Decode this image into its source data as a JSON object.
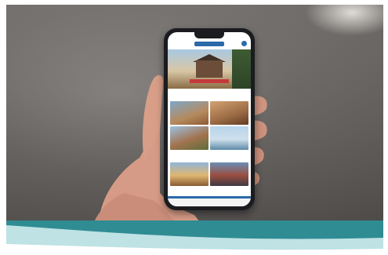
{
  "scene": {
    "description_label": "",
    "colors": {
      "background": "#ffffff",
      "backdrop": "#6f6b68",
      "band_dark": "#2f8c93",
      "band_light": "#bfe2e4",
      "phone_body": "#1b1c1f",
      "app_accent": "#2a6aa8"
    }
  },
  "app_screen": {
    "section_1_title": "",
    "section_2_title": ""
  }
}
